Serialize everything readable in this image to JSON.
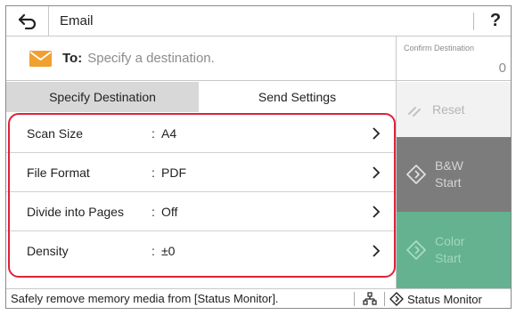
{
  "header": {
    "title": "Email",
    "help_label": "?",
    "back_icon": "back-arrow-icon"
  },
  "destination": {
    "to_label": "To:",
    "placeholder": "Specify a destination.",
    "icon": "envelope-icon",
    "icon_color": "#f0a030"
  },
  "confirm_destination": {
    "label": "Confirm Destination",
    "count": "0"
  },
  "actions": {
    "reset_label": "Reset",
    "bw_start_label_1": "B&W",
    "bw_start_label_2": "Start",
    "color_start_label_1": "Color",
    "color_start_label_2": "Start",
    "bw_color": "#7c7c7c",
    "color_start_color": "#64b28f"
  },
  "tabs": [
    {
      "label": "Specify Destination",
      "active": true
    },
    {
      "label": "Send Settings",
      "active": false
    }
  ],
  "settings": [
    {
      "label": "Scan Size",
      "separator": ":",
      "value": "A4"
    },
    {
      "label": "File Format",
      "separator": ":",
      "value": "PDF"
    },
    {
      "label": "Divide into Pages",
      "separator": ":",
      "value": "Off"
    },
    {
      "label": "Density",
      "separator": ":",
      "value": "±0"
    }
  ],
  "highlight_color": "#e0213a",
  "status_bar": {
    "message": "Safely remove memory media from [Status Monitor].",
    "network_icon": "network-icon",
    "monitor_label": "Status Monitor",
    "monitor_icon": "status-monitor-icon"
  }
}
